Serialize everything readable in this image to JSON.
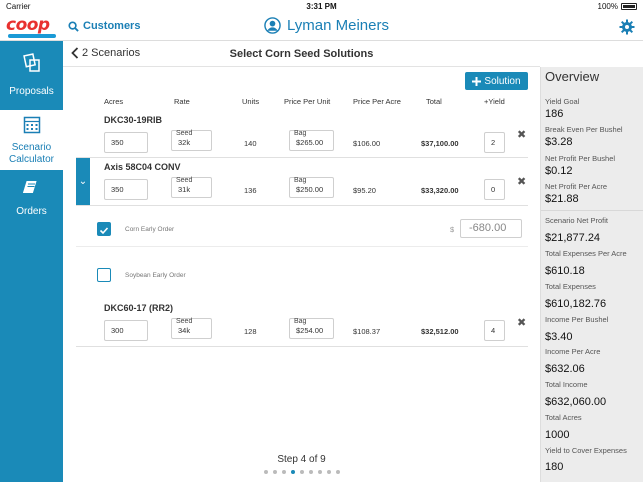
{
  "status": {
    "carrier": "Carrier",
    "time": "3:31 PM",
    "battery": "100%"
  },
  "header": {
    "logo": "coop",
    "customers": "Customers",
    "user": "Lyman Meiners"
  },
  "sidebar": {
    "items": [
      {
        "label1": "Proposals",
        "label2": ""
      },
      {
        "label1": "Scenario",
        "label2": "Calculator"
      },
      {
        "label1": "Orders",
        "label2": ""
      }
    ]
  },
  "page": {
    "back": "2 Scenarios",
    "title": "Select Corn Seed Solutions",
    "add_solution": "Solution",
    "step": "Step 4 of 9"
  },
  "columns": [
    "Acres",
    "Rate",
    "Units",
    "Price Per Unit",
    "Price Per Acre",
    "Total",
    "+Yield"
  ],
  "rows": [
    {
      "name": "DKC30-19RIB",
      "acres": "350",
      "seed_label": "Seed",
      "rate": "32k",
      "units": "140",
      "bag_label": "Bag",
      "price_unit": "$265.00",
      "price_acre": "$106.00",
      "total": "$37,100.00",
      "yield": "2"
    },
    {
      "name": "Axis 58C04 CONV",
      "acres": "350",
      "seed_label": "Seed",
      "rate": "31k",
      "units": "136",
      "bag_label": "Bag",
      "price_unit": "$250.00",
      "price_acre": "$95.20",
      "total": "$33,320.00",
      "yield": "0"
    },
    {
      "name": "DKC60-17 (RR2)",
      "acres": "300",
      "seed_label": "Seed",
      "rate": "34k",
      "units": "128",
      "bag_label": "Bag",
      "price_unit": "$254.00",
      "price_acre": "$108.37",
      "total": "$32,512.00",
      "yield": "4"
    }
  ],
  "discounts": [
    {
      "label": "Corn Early Order",
      "checked": true,
      "currency": "$",
      "value": "-680.00"
    },
    {
      "label": "Soybean Early Order",
      "checked": false
    }
  ],
  "overview": {
    "title": "Overview",
    "group1": [
      {
        "label": "Yield Goal",
        "value": "186"
      },
      {
        "label": "Break Even Per Bushel",
        "value": "$3.28"
      },
      {
        "label": "Net Profit Per Bushel",
        "value": "$0.12"
      },
      {
        "label": "Net Profit Per Acre",
        "value": "$21.88"
      }
    ],
    "group2": [
      {
        "label": "Scenario Net Profit",
        "value": "$21,877.24"
      },
      {
        "label": "Total Expenses Per Acre",
        "value": "$610.18"
      },
      {
        "label": "Total Expenses",
        "value": "$610,182.76"
      },
      {
        "label": "Income Per Bushel",
        "value": "$3.40"
      },
      {
        "label": "Income Per Acre",
        "value": "$632.06"
      },
      {
        "label": "Total Income",
        "value": "$632,060.00"
      },
      {
        "label": "Total Acres",
        "value": "1000"
      },
      {
        "label": "Yield to Cover Expenses",
        "value": "180"
      }
    ]
  },
  "colors": {
    "accent": "#1a8ab8",
    "brand_red": "#e8312f",
    "link": "#1a7fb5"
  }
}
